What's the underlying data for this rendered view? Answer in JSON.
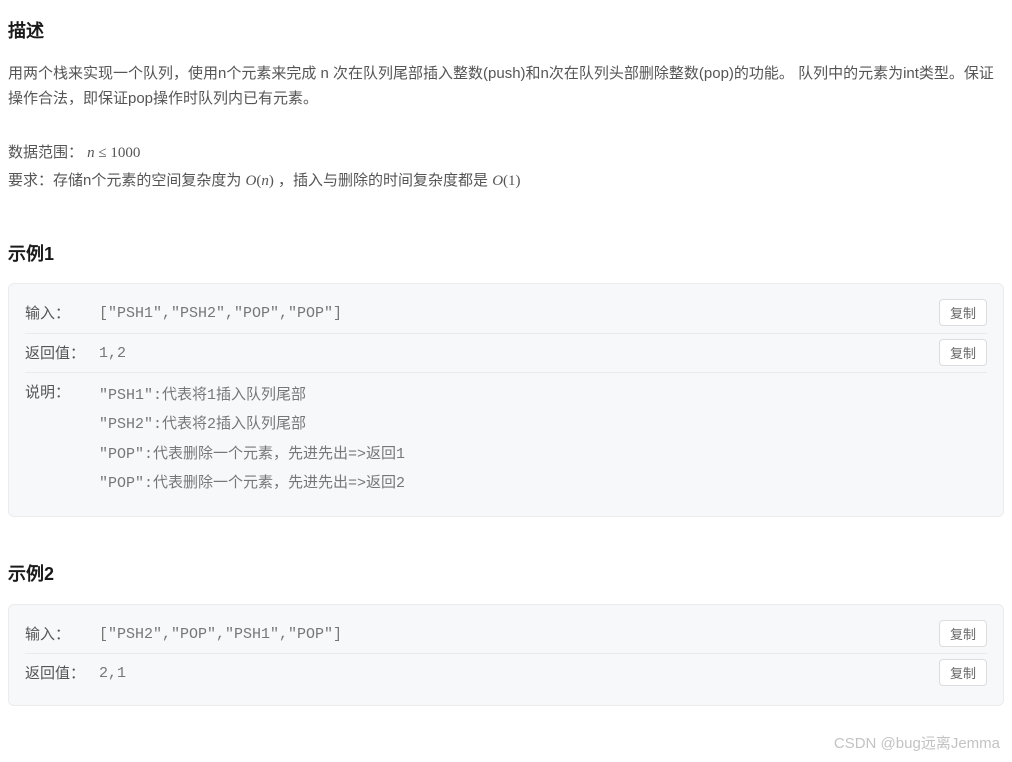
{
  "headings": {
    "desc": "描述",
    "example1": "示例1",
    "example2": "示例2"
  },
  "description": "用两个栈来实现一个队列，使用n个元素来完成 n 次在队列尾部插入整数(push)和n次在队列头部删除整数(pop)的功能。 队列中的元素为int类型。保证操作合法，即保证pop操作时队列内已有元素。",
  "constraints": {
    "range_prefix": "数据范围： ",
    "range_math": "n ≤ 1000",
    "req_prefix": "要求：存储n个元素的空间复杂度为 ",
    "req_on": "O(n)",
    "req_mid": " ，插入与删除的时间复杂度都是 ",
    "req_o1": "O(1)"
  },
  "labels": {
    "input": "输入：",
    "return": "返回值：",
    "explain": "说明：",
    "copy": "复制"
  },
  "example1": {
    "input": "[\"PSH1\",\"PSH2\",\"POP\",\"POP\"]",
    "return": "1,2",
    "explain": [
      "\"PSH1\":代表将1插入队列尾部",
      "\"PSH2\":代表将2插入队列尾部",
      "\"POP\":代表删除一个元素，先进先出=>返回1",
      "\"POP\":代表删除一个元素，先进先出=>返回2"
    ]
  },
  "example2": {
    "input": "[\"PSH2\",\"POP\",\"PSH1\",\"POP\"]",
    "return": "2,1"
  },
  "watermark": "CSDN @bug远离Jemma"
}
